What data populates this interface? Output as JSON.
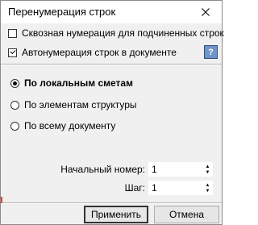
{
  "window": {
    "title": "Перенумерация строк"
  },
  "options": {
    "continuous_numbering": {
      "label": "Сквозная нумерация для подчиненных строк",
      "checked": false
    },
    "auto_numbering": {
      "label": "Автонумерация строк в документе",
      "checked": true
    }
  },
  "help": {
    "glyph": "?"
  },
  "scope": {
    "options": [
      {
        "label": "По локальным сметам",
        "selected": true
      },
      {
        "label": "По элементам структуры",
        "selected": false
      },
      {
        "label": "По всему документу",
        "selected": false
      }
    ]
  },
  "fields": {
    "start_number": {
      "label": "Начальный номер:",
      "value": "1"
    },
    "step": {
      "label": "Шаг:",
      "value": "1"
    }
  },
  "buttons": {
    "apply": "Применить",
    "cancel": "Отмена"
  }
}
